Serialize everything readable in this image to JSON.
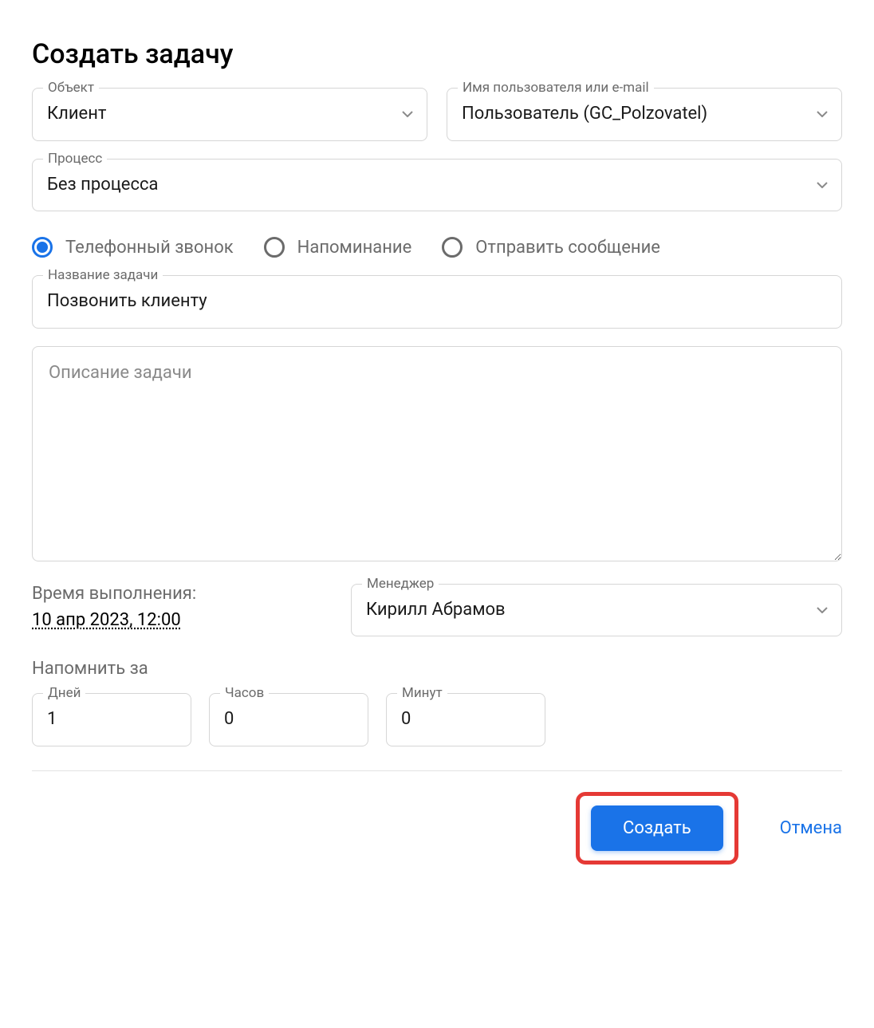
{
  "title": "Создать задачу",
  "fields": {
    "object": {
      "label": "Объект",
      "value": "Клиент"
    },
    "user": {
      "label": "Имя пользователя или e-mail",
      "value": "Пользователь (GC_Polzovatel)"
    },
    "process": {
      "label": "Процесс",
      "value": "Без процесса"
    },
    "task_name": {
      "label": "Название задачи",
      "value": "Позвонить клиенту"
    },
    "description": {
      "placeholder": "Описание задачи"
    },
    "manager": {
      "label": "Менеджер",
      "value": "Кирилл Абрамов"
    }
  },
  "task_types": [
    {
      "label": "Телефонный звонок",
      "selected": true
    },
    {
      "label": "Напоминание",
      "selected": false
    },
    {
      "label": "Отправить сообщение",
      "selected": false
    }
  ],
  "execution_time": {
    "label": "Время выполнения:",
    "value": "10 апр 2023, 12:00"
  },
  "reminder": {
    "label": "Напомнить за",
    "days": {
      "label": "Дней",
      "value": "1"
    },
    "hours": {
      "label": "Часов",
      "value": "0"
    },
    "minutes": {
      "label": "Минут",
      "value": "0"
    }
  },
  "buttons": {
    "create": "Создать",
    "cancel": "Отмена"
  }
}
